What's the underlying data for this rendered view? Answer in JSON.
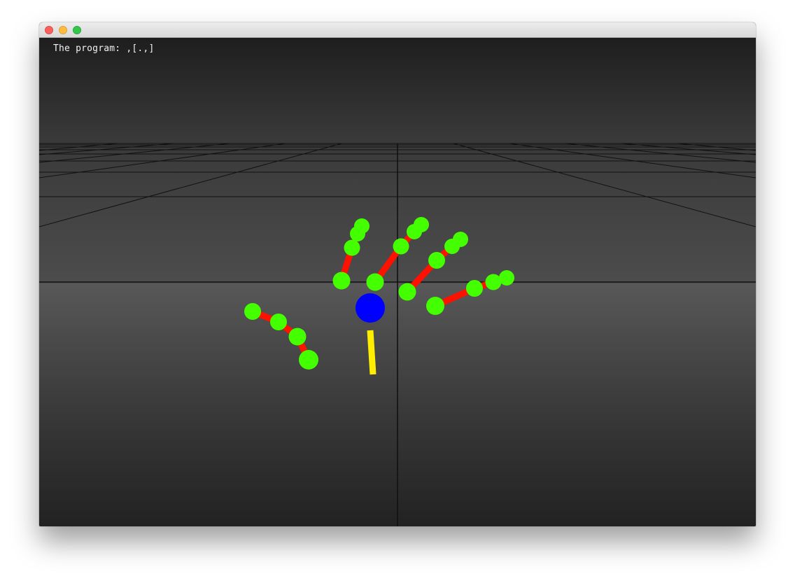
{
  "window": {
    "controls": {
      "close": "close-button",
      "minimize": "minimize-button",
      "zoom": "zoom-button"
    },
    "control_colors": {
      "close": "#fc605c",
      "minimize": "#fdbc40",
      "zoom": "#34c84a"
    }
  },
  "overlay": {
    "program_text": "The program: ,[.,]"
  },
  "scene_colors": {
    "joints": "#44ff00",
    "bones": "#ff1100",
    "palm": "#0000ff",
    "arm": "#ffee00",
    "grid_lines": "#111111"
  }
}
